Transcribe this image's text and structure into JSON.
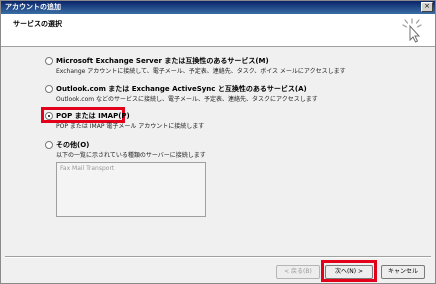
{
  "window": {
    "title": "アカウントの追加",
    "close_glyph": "×"
  },
  "header": {
    "heading": "サービスの選択"
  },
  "options": [
    {
      "label": "Microsoft Exchange Server または互換性のあるサービス(M)",
      "description": "Exchange アカウントに接続して、電子メール、予定表、連絡先、タスク、ボイス メールにアクセスします",
      "checked": false
    },
    {
      "label": "Outlook.com または Exchange ActiveSync と互換性のあるサービス(A)",
      "description": "Outlook.com などのサービスに接続し、電子メール、予定表、連絡先、タスクにアクセスします",
      "checked": false
    },
    {
      "label": "POP または IMAP(P)",
      "description": "POP または IMAP 電子メール アカウントに接続します",
      "checked": true
    },
    {
      "label": "その他(O)",
      "description": "以下の一覧に示されている種類のサーバーに接続します",
      "checked": false
    }
  ],
  "server_list": {
    "items": [
      "Fax Mail Transport"
    ]
  },
  "buttons": {
    "back": "< 戻る(B)",
    "next": "次へ(N) >",
    "cancel": "キャンセル"
  },
  "colors": {
    "highlight": "#e3001b",
    "titlebar": "#0a246a"
  }
}
